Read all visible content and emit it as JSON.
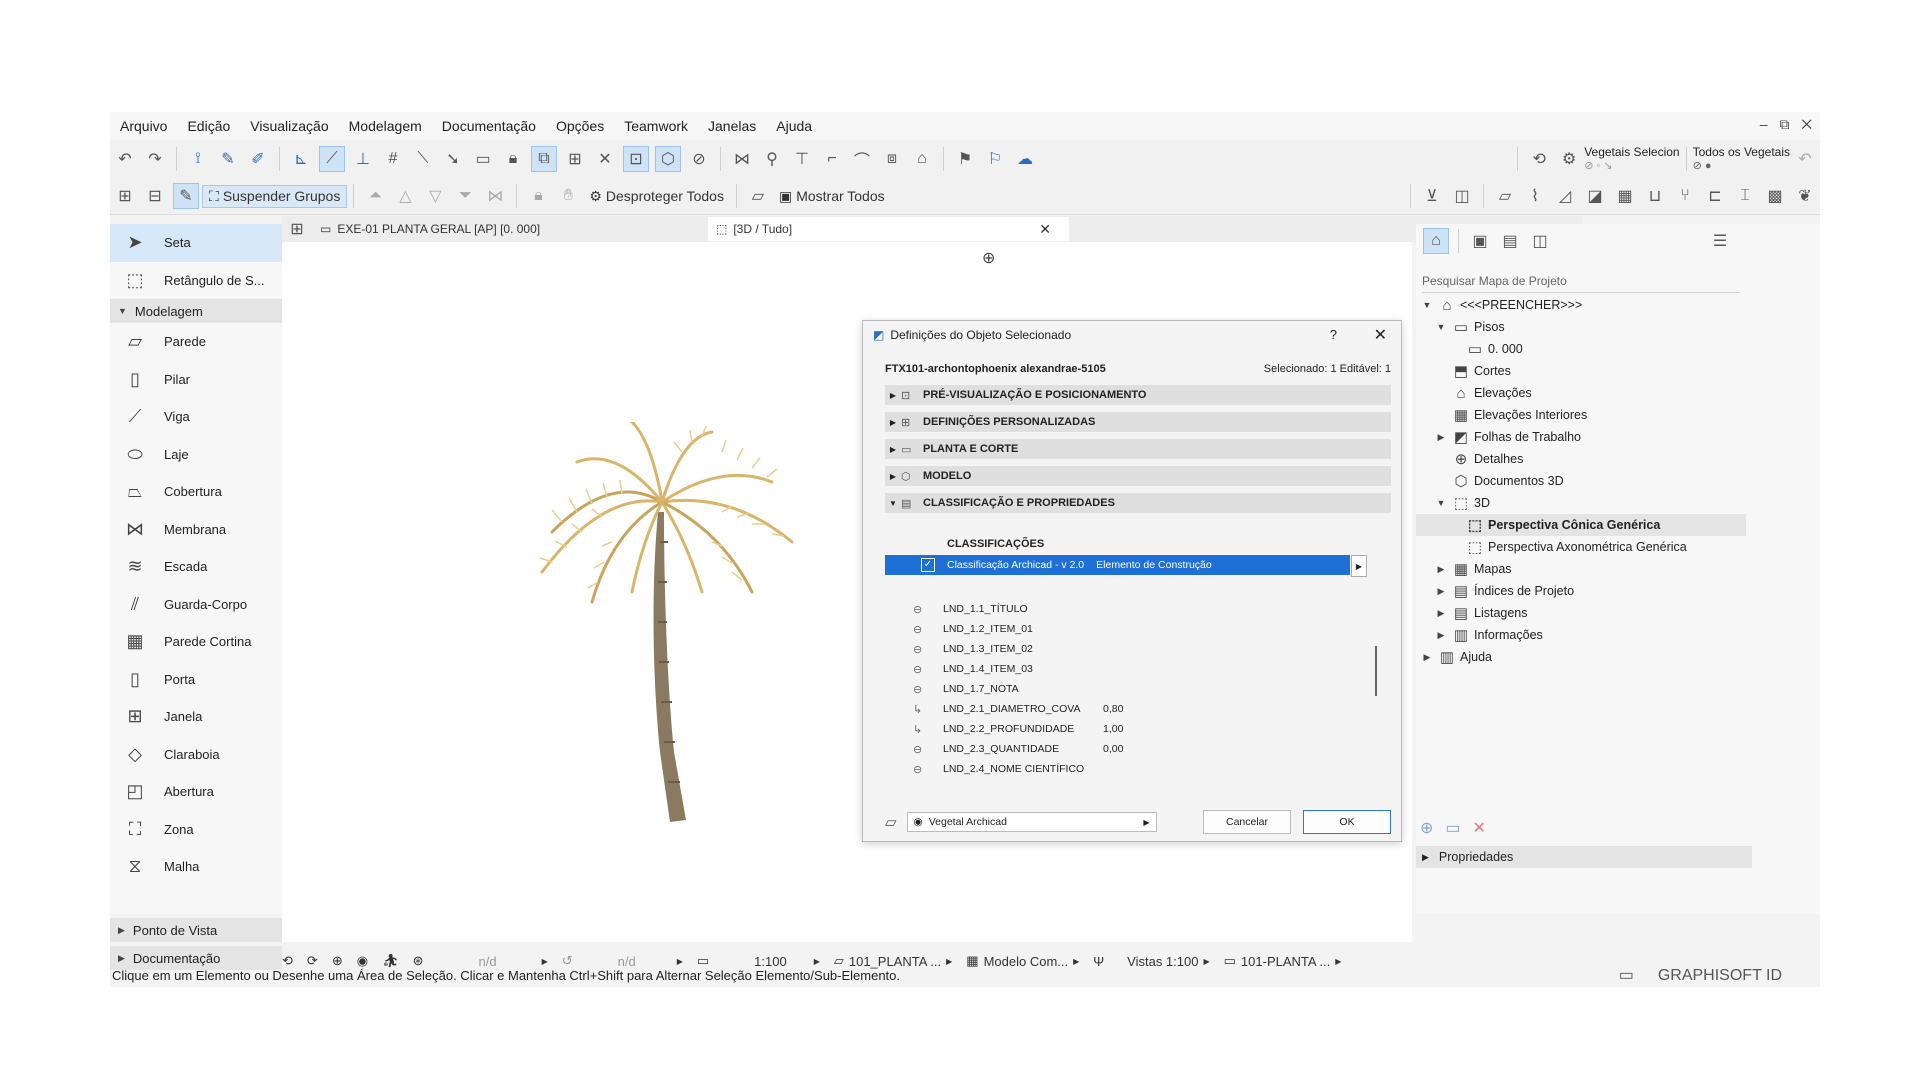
{
  "menu": [
    "Arquivo",
    "Edição",
    "Visualização",
    "Modelagem",
    "Documentação",
    "Opções",
    "Teamwork",
    "Janelas",
    "Ajuda"
  ],
  "window_controls": "– ⧉ ✕",
  "toolbar2": {
    "suspend_groups": "Suspender Grupos",
    "unprotect_all": "Desproteger Todos",
    "show_all": "Mostrar Todos"
  },
  "favorites": {
    "veg_selected": "Vegetais Selecion",
    "veg_all": "Todos os Vegetais"
  },
  "toolbox": {
    "arrow": "Seta",
    "marquee": "Retângulo de S...",
    "modeling_group": "Modelagem",
    "tools": [
      "Parede",
      "Pilar",
      "Viga",
      "Laje",
      "Cobertura",
      "Membrana",
      "Escada",
      "Guarda-Corpo",
      "Parede Cortina",
      "Porta",
      "Janela",
      "Claraboia",
      "Abertura",
      "Zona",
      "Malha"
    ],
    "viewpoint_group": "Ponto de Vista",
    "documentation_group": "Documentação"
  },
  "tabs": {
    "plan": "EXE-01 PLANTA GERAL [AP] [0. 000]",
    "view3d": "[3D / Tudo]"
  },
  "dialog": {
    "title": "Definições do Objeto Selecionado",
    "help": "?",
    "close": "✕",
    "object_name": "FTX101-archontophoenix alexandrae-5105",
    "selected_info": "Selecionado: 1 Editável: 1",
    "sections": [
      "PRÉ-VISUALIZAÇÃO E POSICIONAMENTO",
      "DEFINIÇÕES PERSONALIZADAS",
      "PLANTA E CORTE",
      "MODELO",
      "CLASSIFICAÇÃO E PROPRIEDADES"
    ],
    "classifications_label": "CLASSIFICAÇÕES",
    "classification_system": "Classificação Archicad - v 2.0",
    "classification_value": "Elemento de Construção",
    "properties": [
      {
        "name": "LND_1.1_TÍTULO",
        "value": ""
      },
      {
        "name": "LND_1.2_ITEM_01",
        "value": ""
      },
      {
        "name": "LND_1.3_ITEM_02",
        "value": ""
      },
      {
        "name": "LND_1.4_ITEM_03",
        "value": ""
      },
      {
        "name": "LND_1.7_NOTA",
        "value": ""
      },
      {
        "name": "LND_2.1_DIAMETRO_COVA",
        "value": "0,80"
      },
      {
        "name": "LND_2.2_PROFUNDIDADE",
        "value": "1,00"
      },
      {
        "name": "LND_2.3_QUANTIDADE",
        "value": "0,00"
      },
      {
        "name": "LND_2.4_NOME CIENTÍFICO",
        "value": ""
      }
    ],
    "layer": "Vegetal Archicad",
    "cancel": "Cancelar",
    "ok": "OK"
  },
  "navigator": {
    "search_placeholder": "Pesquisar Mapa de Projeto",
    "root": "<<<PREENCHER>>>",
    "items": [
      "Pisos",
      "0. 000",
      "Cortes",
      "Elevações",
      "Elevações Interiores",
      "Folhas de Trabalho",
      "Detalhes",
      "Documentos 3D",
      "3D",
      "Perspectiva Cônica Genérica",
      "Perspectiva Axonométrica Genérica",
      "Mapas",
      "Índices de Projeto",
      "Listagens",
      "Informações",
      "Ajuda"
    ],
    "properties": "Propriedades"
  },
  "bottombar": {
    "nd1": "n/d",
    "nd2": "n/d",
    "scale": "1:100",
    "layout": "101_PLANTA ...",
    "model_view": "Modelo Com...",
    "views": "Vistas 1:100",
    "sheet": "101-PLANTA ..."
  },
  "status": {
    "hint": "Clique em um Elemento ou Desenhe uma Área de Seleção. Clicar e Mantenha Ctrl+Shift para Alternar Seleção Elemento/Sub-Elemento.",
    "graphisoft": "GRAPHISOFT ID"
  }
}
